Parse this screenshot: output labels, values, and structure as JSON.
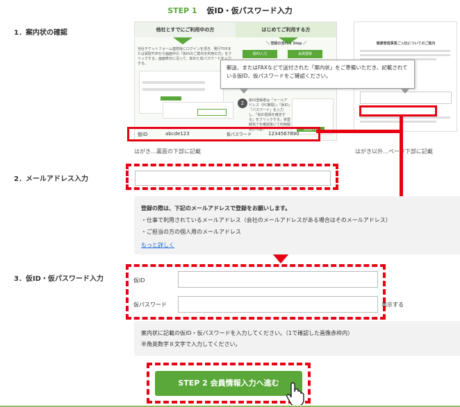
{
  "header": {
    "step_label": "STEP 1",
    "title": "仮ID・仮パスワード入力"
  },
  "sections": {
    "s1": "1．案内状の確認",
    "s2": "2．メールアドレス入力",
    "s3": "3．仮ID・仮パスワード入力"
  },
  "illustration": {
    "left_header": "他社とすでにご利用中の方",
    "right_header": "はじめてご利用する方",
    "left_text": "当社チケットフォーム連携後にログインを頂き、発行TOPまたは受取TOPから画面中の「仮IDのご案内を利用の方」をクリックする。画面表示に沿って、仮IDと仮パスワードを入力する。",
    "flow_text": "＼ 登録の流れ 2 Step ／",
    "btn_a": "仮ID入力",
    "btn_b": "会員登録",
    "bottom_text": "仮ID登録者は「メールアドレス（PC推奨）」「仮ID」「パスワード」を入力し、「仮ID登録を確定する」をクリックする。仮登録完了を確認後にて利用開始が可能！",
    "green_btn": "仮登録する",
    "doc_title": "健康管理事業ご入社についてのご案内",
    "id_label": "仮ID",
    "id_value": "abcde123",
    "pw_label": "仮パスワード",
    "pw_value": "1234567890",
    "caption_left": "はがき…裏面の下部に記載",
    "caption_right": "はがき以外…ページ下部に記載"
  },
  "tooltip": "郵送、またはFAXなどで送付された「案内状」をご準備いただき、記載されている仮ID、仮パスワードをご確認ください。",
  "email": {
    "value": "",
    "placeholder": ""
  },
  "email_note": {
    "title": "登録の際は、下記のメールアドレスで登録をお願いします。",
    "line1": "・仕事で利用されているメールアドレス（会社のメールアドレスがある場合はそのメールアドレス）",
    "line2": "・ご担当の方の個人用のメールアドレス",
    "link": "もっと詳しく"
  },
  "credentials": {
    "id_label": "仮ID",
    "pw_label": "仮パスワード",
    "show_label": "表示する",
    "note1": "案内状に記載の仮ID・仮パスワードを入力してください。（1で確認した画像赤枠内）",
    "note2": "半角英数字８文字で入力してください。"
  },
  "submit": {
    "label": "STEP 2 会員情報入力へ進む"
  },
  "colors": {
    "accent_green": "#5aa83a",
    "highlight_red": "#e60012"
  }
}
